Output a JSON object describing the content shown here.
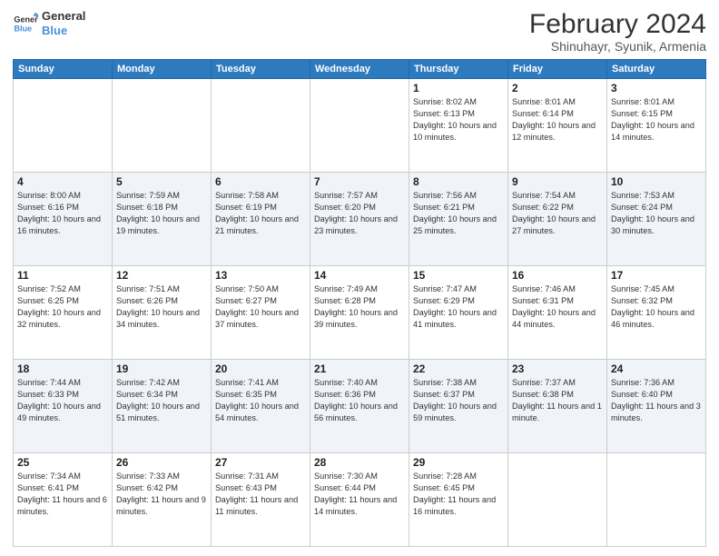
{
  "logo": {
    "line1": "General",
    "line2": "Blue"
  },
  "title": "February 2024",
  "subtitle": "Shinuhayr, Syunik, Armenia",
  "days": [
    "Sunday",
    "Monday",
    "Tuesday",
    "Wednesday",
    "Thursday",
    "Friday",
    "Saturday"
  ],
  "weeks": [
    [
      {
        "date": "",
        "info": ""
      },
      {
        "date": "",
        "info": ""
      },
      {
        "date": "",
        "info": ""
      },
      {
        "date": "",
        "info": ""
      },
      {
        "date": "1",
        "info": "Sunrise: 8:02 AM\nSunset: 6:13 PM\nDaylight: 10 hours and 10 minutes."
      },
      {
        "date": "2",
        "info": "Sunrise: 8:01 AM\nSunset: 6:14 PM\nDaylight: 10 hours and 12 minutes."
      },
      {
        "date": "3",
        "info": "Sunrise: 8:01 AM\nSunset: 6:15 PM\nDaylight: 10 hours and 14 minutes."
      }
    ],
    [
      {
        "date": "4",
        "info": "Sunrise: 8:00 AM\nSunset: 6:16 PM\nDaylight: 10 hours and 16 minutes."
      },
      {
        "date": "5",
        "info": "Sunrise: 7:59 AM\nSunset: 6:18 PM\nDaylight: 10 hours and 19 minutes."
      },
      {
        "date": "6",
        "info": "Sunrise: 7:58 AM\nSunset: 6:19 PM\nDaylight: 10 hours and 21 minutes."
      },
      {
        "date": "7",
        "info": "Sunrise: 7:57 AM\nSunset: 6:20 PM\nDaylight: 10 hours and 23 minutes."
      },
      {
        "date": "8",
        "info": "Sunrise: 7:56 AM\nSunset: 6:21 PM\nDaylight: 10 hours and 25 minutes."
      },
      {
        "date": "9",
        "info": "Sunrise: 7:54 AM\nSunset: 6:22 PM\nDaylight: 10 hours and 27 minutes."
      },
      {
        "date": "10",
        "info": "Sunrise: 7:53 AM\nSunset: 6:24 PM\nDaylight: 10 hours and 30 minutes."
      }
    ],
    [
      {
        "date": "11",
        "info": "Sunrise: 7:52 AM\nSunset: 6:25 PM\nDaylight: 10 hours and 32 minutes."
      },
      {
        "date": "12",
        "info": "Sunrise: 7:51 AM\nSunset: 6:26 PM\nDaylight: 10 hours and 34 minutes."
      },
      {
        "date": "13",
        "info": "Sunrise: 7:50 AM\nSunset: 6:27 PM\nDaylight: 10 hours and 37 minutes."
      },
      {
        "date": "14",
        "info": "Sunrise: 7:49 AM\nSunset: 6:28 PM\nDaylight: 10 hours and 39 minutes."
      },
      {
        "date": "15",
        "info": "Sunrise: 7:47 AM\nSunset: 6:29 PM\nDaylight: 10 hours and 41 minutes."
      },
      {
        "date": "16",
        "info": "Sunrise: 7:46 AM\nSunset: 6:31 PM\nDaylight: 10 hours and 44 minutes."
      },
      {
        "date": "17",
        "info": "Sunrise: 7:45 AM\nSunset: 6:32 PM\nDaylight: 10 hours and 46 minutes."
      }
    ],
    [
      {
        "date": "18",
        "info": "Sunrise: 7:44 AM\nSunset: 6:33 PM\nDaylight: 10 hours and 49 minutes."
      },
      {
        "date": "19",
        "info": "Sunrise: 7:42 AM\nSunset: 6:34 PM\nDaylight: 10 hours and 51 minutes."
      },
      {
        "date": "20",
        "info": "Sunrise: 7:41 AM\nSunset: 6:35 PM\nDaylight: 10 hours and 54 minutes."
      },
      {
        "date": "21",
        "info": "Sunrise: 7:40 AM\nSunset: 6:36 PM\nDaylight: 10 hours and 56 minutes."
      },
      {
        "date": "22",
        "info": "Sunrise: 7:38 AM\nSunset: 6:37 PM\nDaylight: 10 hours and 59 minutes."
      },
      {
        "date": "23",
        "info": "Sunrise: 7:37 AM\nSunset: 6:38 PM\nDaylight: 11 hours and 1 minute."
      },
      {
        "date": "24",
        "info": "Sunrise: 7:36 AM\nSunset: 6:40 PM\nDaylight: 11 hours and 3 minutes."
      }
    ],
    [
      {
        "date": "25",
        "info": "Sunrise: 7:34 AM\nSunset: 6:41 PM\nDaylight: 11 hours and 6 minutes."
      },
      {
        "date": "26",
        "info": "Sunrise: 7:33 AM\nSunset: 6:42 PM\nDaylight: 11 hours and 9 minutes."
      },
      {
        "date": "27",
        "info": "Sunrise: 7:31 AM\nSunset: 6:43 PM\nDaylight: 11 hours and 11 minutes."
      },
      {
        "date": "28",
        "info": "Sunrise: 7:30 AM\nSunset: 6:44 PM\nDaylight: 11 hours and 14 minutes."
      },
      {
        "date": "29",
        "info": "Sunrise: 7:28 AM\nSunset: 6:45 PM\nDaylight: 11 hours and 16 minutes."
      },
      {
        "date": "",
        "info": ""
      },
      {
        "date": "",
        "info": ""
      }
    ]
  ]
}
